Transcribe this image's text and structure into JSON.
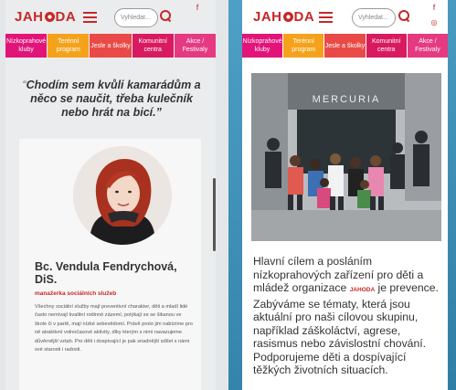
{
  "brand": {
    "logo_left": "JAH",
    "logo_right": "DA",
    "accent": "#c62828"
  },
  "search": {
    "placeholder": "Vyhledat..."
  },
  "social_icons": [
    "facebook-icon",
    "instagram-icon"
  ],
  "nav": {
    "items": [
      {
        "label": "Nízkoprahové kluby",
        "color": "#e2147a"
      },
      {
        "label": "Terénní program",
        "color": "#f5a21b"
      },
      {
        "label": "Jesle a školky",
        "color": "#e94a47"
      },
      {
        "label": "Komunitní centra",
        "color": "#d81b60"
      },
      {
        "label": "Akce / Festivaly",
        "color": "#e53a82"
      }
    ]
  },
  "left": {
    "quote_mark": "“",
    "quote": "Chodím sem kvůli kamarádům a něco se naučit, třeba kulečník nebo hrát na bicí.”",
    "person": {
      "name": "Bc. Vendula Fendrychová, DiS.",
      "role": "manažerka sociálních služeb",
      "bio": "Všechny sociální služby mají preventivní charakter, děti a mladí lidé často nemívají kvalitní rodinné zázemí, potýkají se se šikanou ve škole či v partě, mají nízké sebevědomí. Právě proto jim nabízíme pro ně atraktivní volnočasové aktivity, díky kterým s nimi navazujeme důvěrnější vztah. Pro děti i dospívající je pak snadnější sdílet s námi své starosti i radosti."
    }
  },
  "right": {
    "photo_sign": "MERCURIA",
    "mission_before": "Hlavní cílem a posláním nízkoprahových zařízení pro děti a mládež organizace ",
    "mission_brand": "JAHODA",
    "mission_after": " je prevence. Zabýváme se tématy, která jsou aktuální pro naši cílovou skupinu, například záškoláctví, agrese, rasismus nebo závislostní chování. Podporujeme děti a dospívající těžkých životních situacích."
  }
}
